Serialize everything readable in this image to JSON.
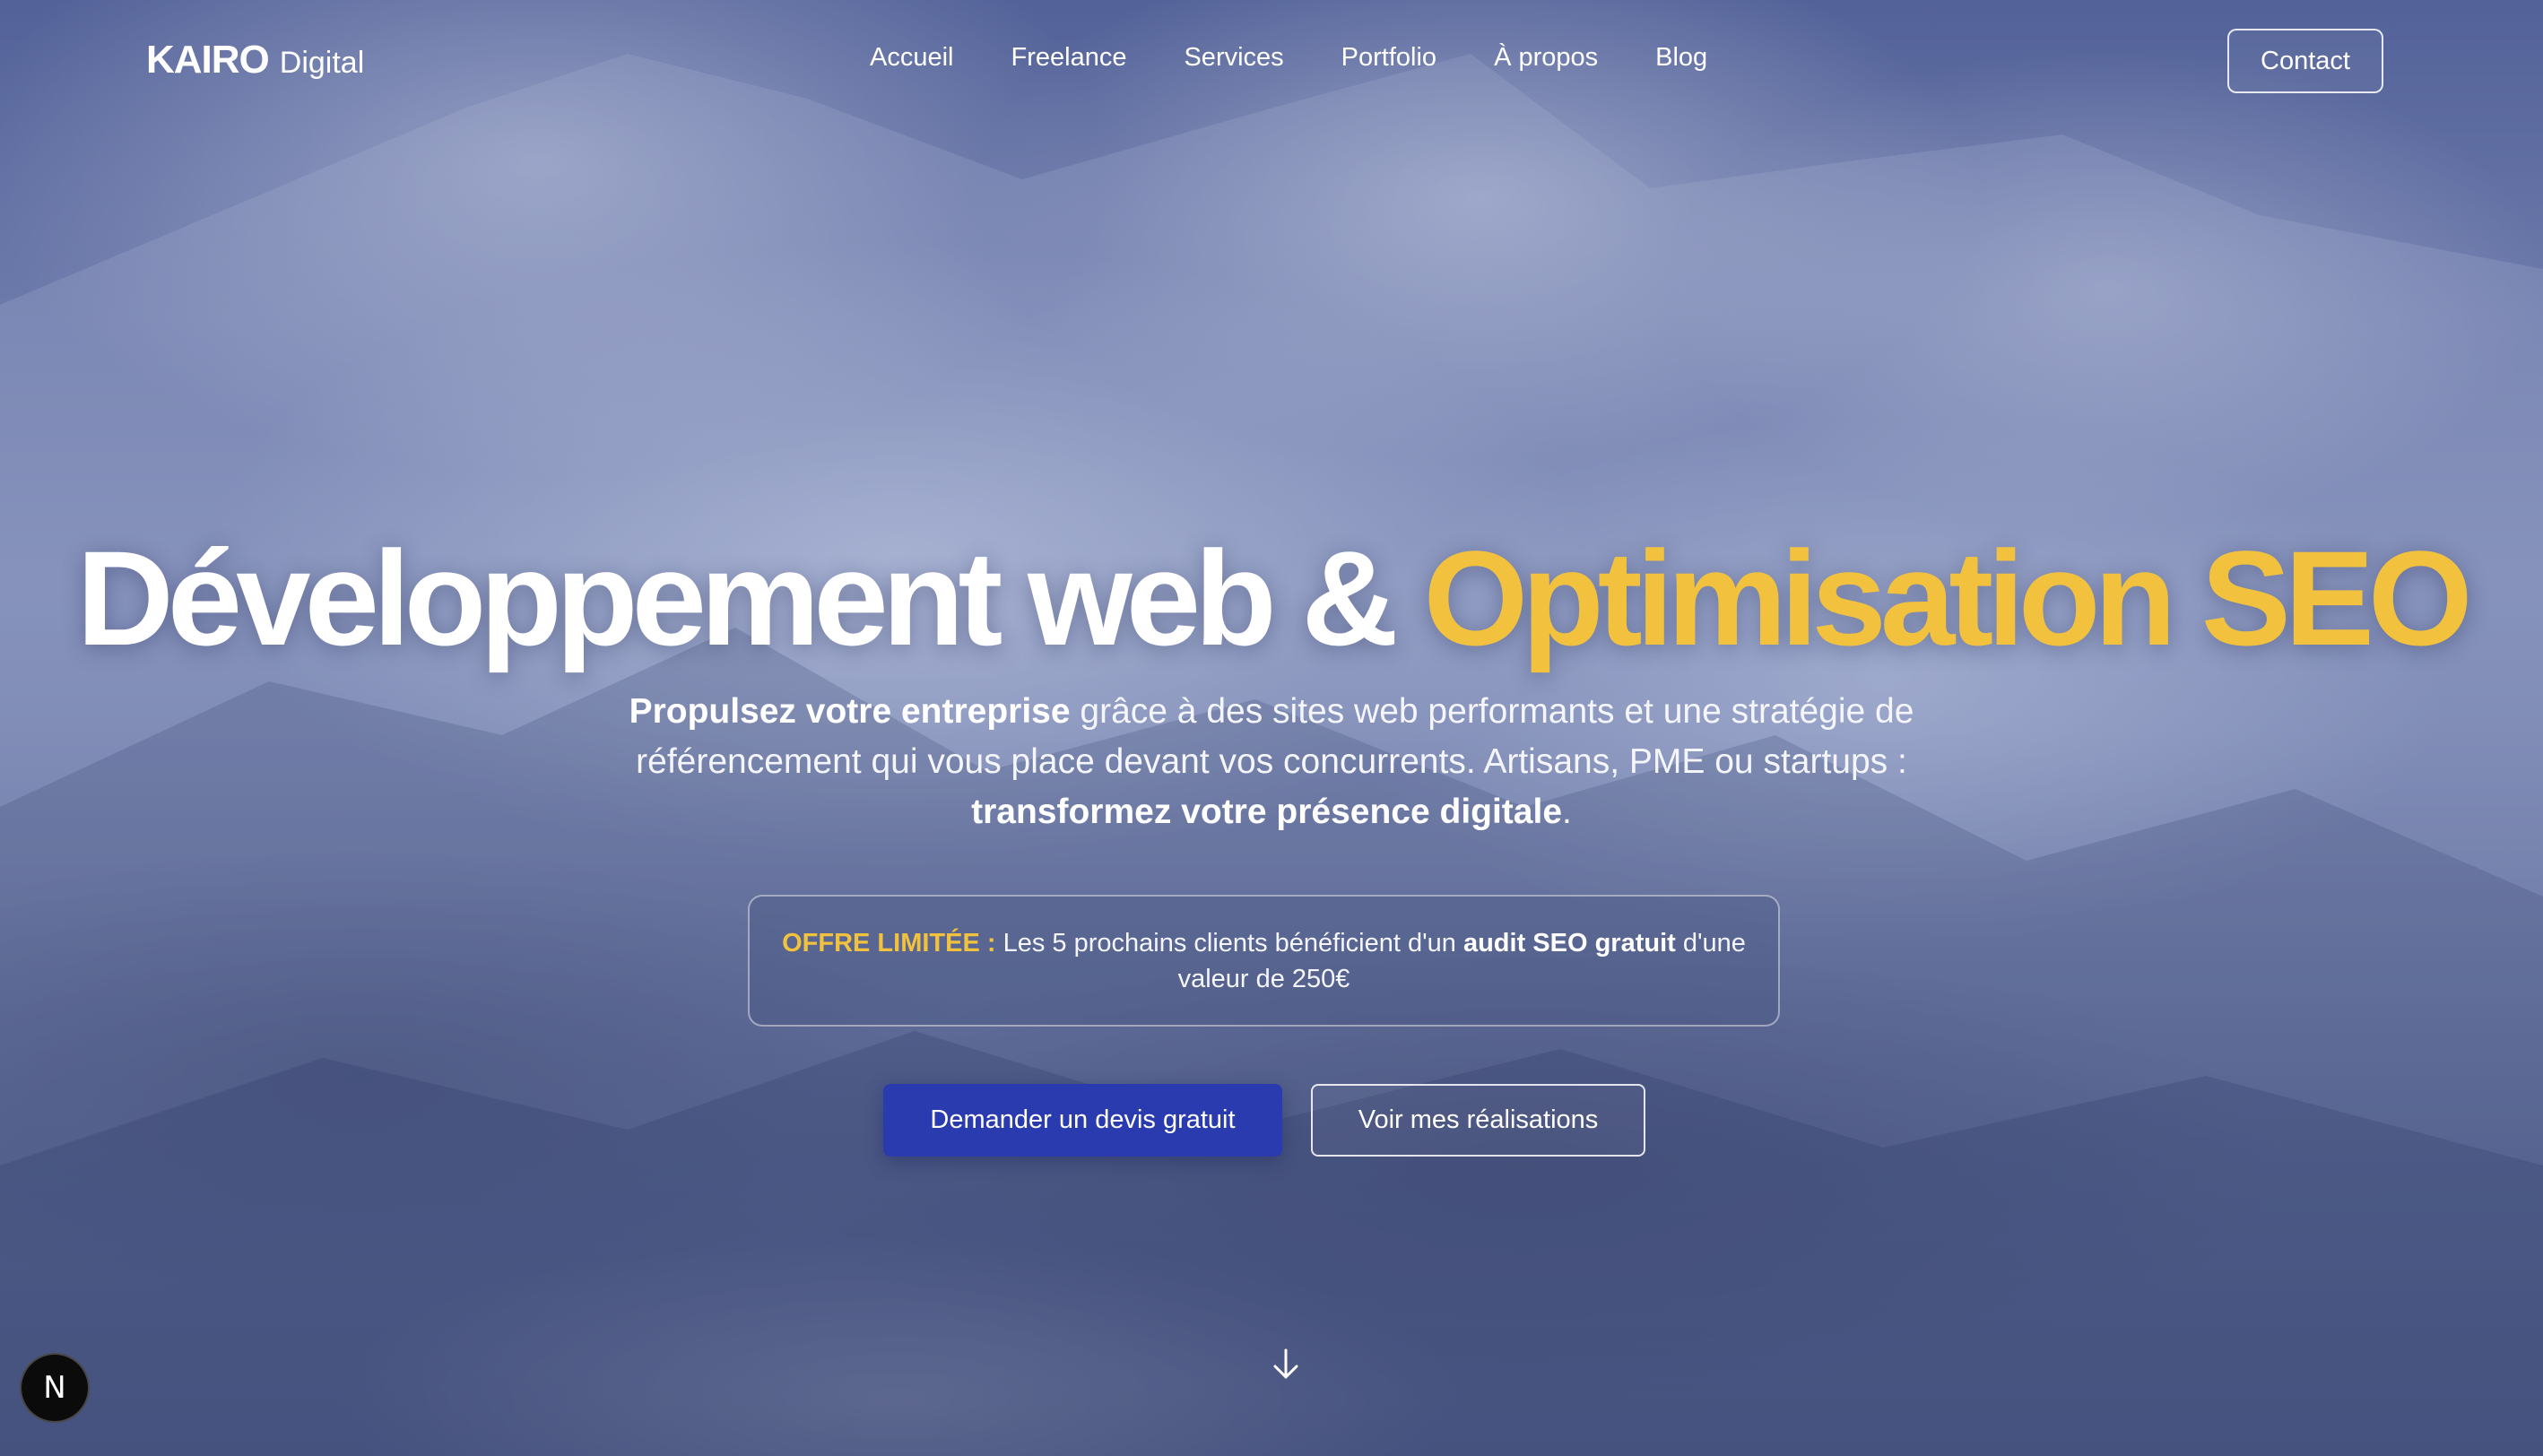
{
  "brand": {
    "name_strong": "KAIRO",
    "name_light": "Digital"
  },
  "nav": {
    "links": [
      "Accueil",
      "Freelance",
      "Services",
      "Portfolio",
      "À propos",
      "Blog"
    ],
    "contact_label": "Contact"
  },
  "hero": {
    "title_main": "Développement web & ",
    "title_accent": "Optimisation SEO",
    "subtitle_strong_1": "Propulsez votre entreprise",
    "subtitle_text_1": " grâce à des sites web performants et une stratégie de référencement qui vous place devant vos concurrents. Artisans, PME ou startups : ",
    "subtitle_strong_2": "transformez votre présence digitale",
    "subtitle_text_2": ".",
    "offer": {
      "tag": "OFFRE LIMITÉE :",
      "text_1": " Les 5 prochains clients bénéficient d'un ",
      "strong": "audit SEO gratuit",
      "text_2": " d'une valeur de 250€"
    },
    "cta_primary": "Demander un devis gratuit",
    "cta_secondary": "Voir mes réalisations"
  },
  "icons": {
    "scroll": "arrow-down-icon",
    "dev_badge": "N"
  },
  "colors": {
    "accent": "#f2c23f",
    "primary_button": "#2a3bb0",
    "background_tint": "#5c6ba0"
  }
}
